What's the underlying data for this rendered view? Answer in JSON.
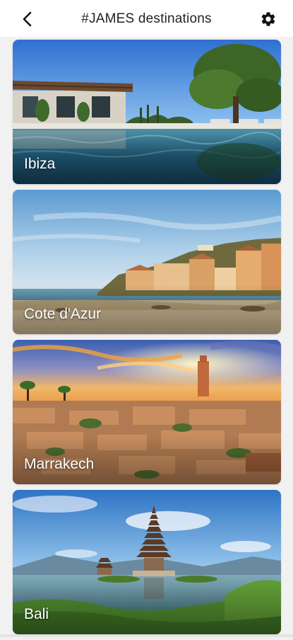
{
  "header": {
    "title": "#JAMES destinations",
    "back_icon": "arrow-back-icon",
    "settings_icon": "gear-icon"
  },
  "destinations": [
    {
      "label": "Ibiza"
    },
    {
      "label": "Cote d'Azur"
    },
    {
      "label": "Marrakech"
    },
    {
      "label": "Bali"
    }
  ],
  "colors": {
    "background": "#f1f1f1",
    "header_bg": "#ffffff",
    "title_text": "#222222",
    "card_label": "#ffffff"
  }
}
